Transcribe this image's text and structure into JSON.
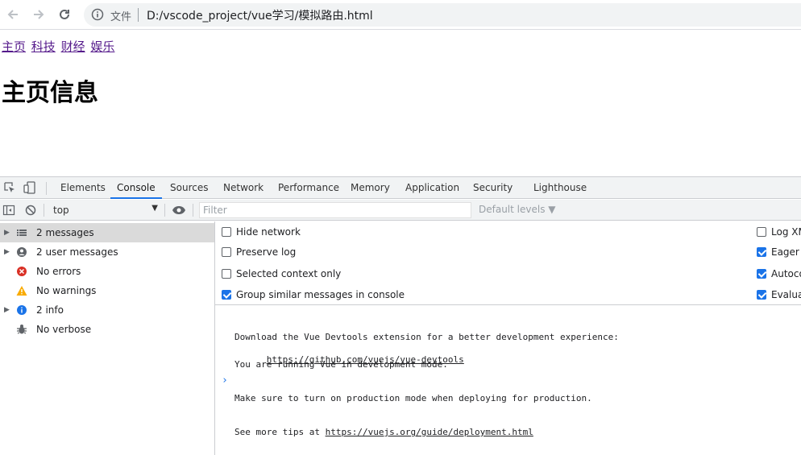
{
  "browser": {
    "file_label": "文件",
    "url": "D:/vscode_project/vue学习/模拟路由.html"
  },
  "page": {
    "nav_links": [
      "主页",
      "科技",
      "财经",
      "娱乐"
    ],
    "heading": "主页信息"
  },
  "devtools": {
    "tabs": [
      "Elements",
      "Console",
      "Sources",
      "Network",
      "Performance",
      "Memory",
      "Application",
      "Security",
      "Lighthouse"
    ],
    "active_tab": "Console",
    "context": "top",
    "filter_placeholder": "Filter",
    "levels": "Default levels ▼",
    "sidebar": [
      {
        "label": "2 messages",
        "icon": "list-icon",
        "expandable": true,
        "selected": true
      },
      {
        "label": "2 user messages",
        "icon": "user-icon",
        "expandable": true,
        "selected": false
      },
      {
        "label": "No errors",
        "icon": "error-icon",
        "expandable": false,
        "selected": false
      },
      {
        "label": "No warnings",
        "icon": "warning-icon",
        "expandable": false,
        "selected": false
      },
      {
        "label": "2 info",
        "icon": "info-icon",
        "expandable": true,
        "selected": false
      },
      {
        "label": "No verbose",
        "icon": "bug-icon",
        "expandable": false,
        "selected": false
      }
    ],
    "settings_left": [
      {
        "label": "Hide network",
        "checked": false
      },
      {
        "label": "Preserve log",
        "checked": false
      },
      {
        "label": "Selected context only",
        "checked": false
      },
      {
        "label": "Group similar messages in console",
        "checked": true
      }
    ],
    "settings_right": [
      {
        "label": "Log XM",
        "checked": false
      },
      {
        "label": "Eager e",
        "checked": true
      },
      {
        "label": "Autoco",
        "checked": true
      },
      {
        "label": "Evaluat",
        "checked": true
      }
    ],
    "messages": [
      {
        "line1": "Download the Vue Devtools extension for a better development experience:",
        "link": "https://github.com/vuejs/vue-devtools"
      },
      {
        "line1": "You are running Vue in development mode.",
        "line2": "Make sure to turn on production mode when deploying for production.",
        "line3_prefix": "See more tips at ",
        "link": "https://vuejs.org/guide/deployment.html"
      }
    ],
    "prompt": "›"
  },
  "colors": {
    "accent": "#1a73e8",
    "link_visited": "#551a8b",
    "error": "#d93025",
    "warning": "#f9ab00",
    "info": "#1a73e8"
  }
}
